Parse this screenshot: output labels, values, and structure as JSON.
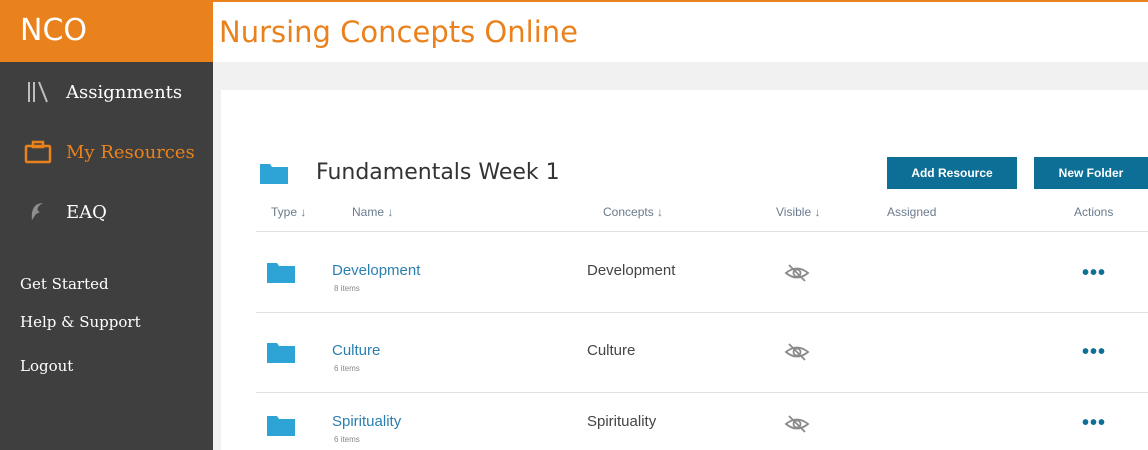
{
  "app": {
    "logo": "NCO",
    "title": "Nursing Concepts Online",
    "accent_color": "#e9821d",
    "sidebar_color": "#3f3f3f",
    "button_color": "#0d6e96"
  },
  "sidebar": {
    "nav": [
      {
        "label": "Assignments",
        "icon": "library-books-icon",
        "active": false
      },
      {
        "label": "My Resources",
        "icon": "briefcase-icon",
        "active": true
      },
      {
        "label": "EAQ",
        "icon": "eaq-icon",
        "active": false
      }
    ],
    "links": [
      "Get Started",
      "Help & Support",
      "Logout"
    ]
  },
  "folder": {
    "title": "Fundamentals Week 1",
    "add_resource_label": "Add Resource",
    "new_folder_label": "New Folder"
  },
  "table": {
    "columns": [
      "Type ↓",
      "Name ↓",
      "Concepts ↓",
      "Visible ↓",
      "Assigned",
      "Actions"
    ],
    "rows": [
      {
        "name": "Development",
        "count": "8 items",
        "concept": "Development",
        "visible_icon": "eye-off-icon",
        "assigned": "",
        "actions": "•••"
      },
      {
        "name": "Culture",
        "count": "6 items",
        "concept": "Culture",
        "visible_icon": "eye-off-icon",
        "assigned": "",
        "actions": "•••"
      },
      {
        "name": "Spirituality",
        "count": "6 items",
        "concept": "Spirituality",
        "visible_icon": "eye-off-icon",
        "assigned": "",
        "actions": "•••"
      }
    ]
  }
}
